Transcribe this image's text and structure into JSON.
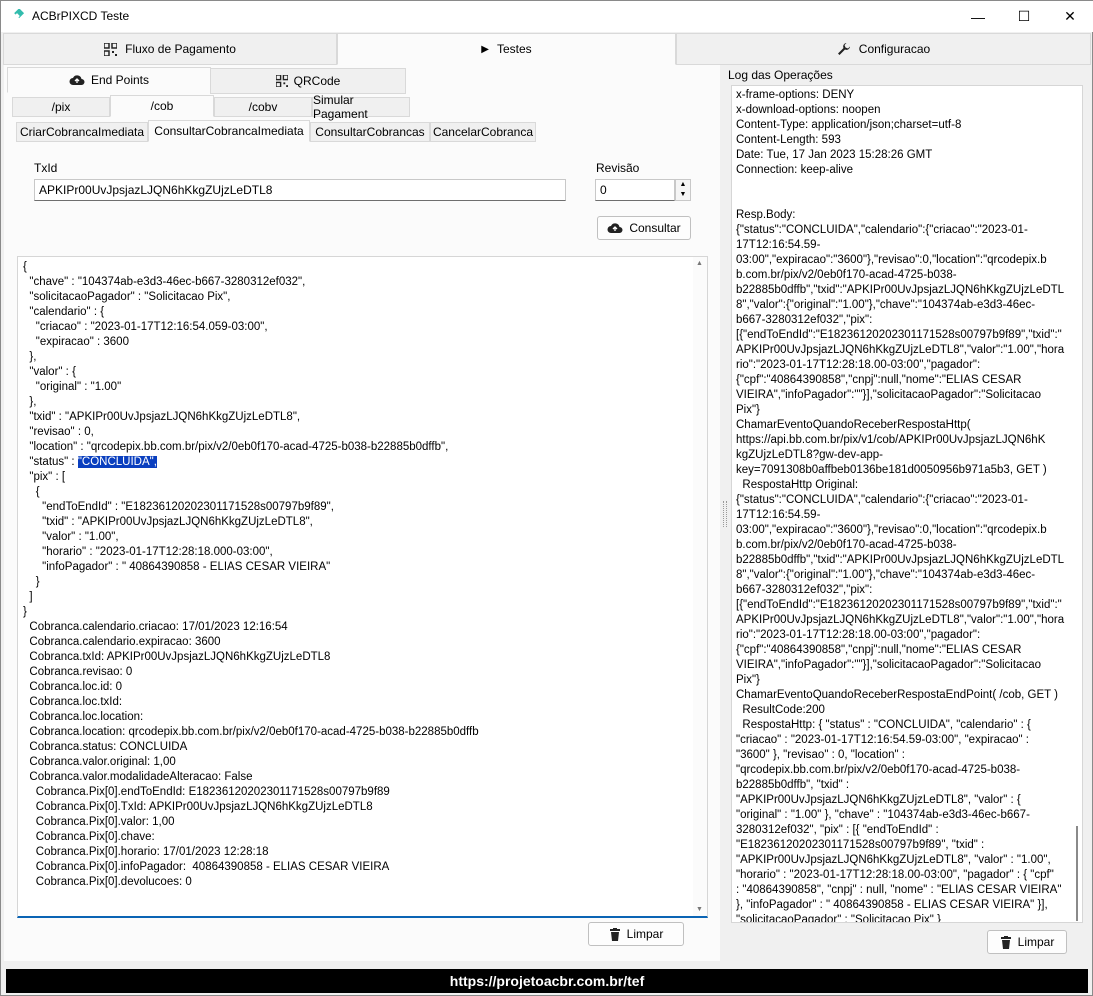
{
  "window": {
    "title": "ACBrPIXCD Teste",
    "controls": {
      "minimize": "—",
      "maximize": "☐",
      "close": "✕"
    }
  },
  "main_tabs": [
    {
      "label": "Fluxo de Pagamento",
      "icon": "qrcode-icon"
    },
    {
      "label": "Testes",
      "icon": "play-icon",
      "active": true
    },
    {
      "label": "Configuracao",
      "icon": "wrench-icon"
    }
  ],
  "sub_tabs": [
    {
      "label": "End Points",
      "icon": "cloud-upload-icon",
      "active": true
    },
    {
      "label": "QRCode",
      "icon": "qrcode-icon"
    }
  ],
  "endpoint_tabs": [
    {
      "label": "/pix"
    },
    {
      "label": "/cob",
      "active": true
    },
    {
      "label": "/cobv"
    },
    {
      "label": "Simular Pagament"
    }
  ],
  "cob_tabs": [
    {
      "label": "CriarCobrancaImediata"
    },
    {
      "label": "ConsultarCobrancaImediata",
      "active": true
    },
    {
      "label": "ConsultarCobrancas"
    },
    {
      "label": "CancelarCobranca"
    }
  ],
  "form": {
    "txid_label": "TxId",
    "txid_value": "APKIPr00UvJpsjazLJQN6hKkgZUjzLeDTL8",
    "revisao_label": "Revisão",
    "revisao_value": "0",
    "consultar_label": "Consultar"
  },
  "result": {
    "before_highlight": "{\n  \"chave\" : \"104374ab-e3d3-46ec-b667-3280312ef032\",\n  \"solicitacaoPagador\" : \"Solicitacao Pix\",\n  \"calendario\" : {\n    \"criacao\" : \"2023-01-17T12:16:54.059-03:00\",\n    \"expiracao\" : 3600\n  },\n  \"valor\" : {\n    \"original\" : \"1.00\"\n  },\n  \"txid\" : \"APKIPr00UvJpsjazLJQN6hKkgZUjzLeDTL8\",\n  \"revisao\" : 0,\n  \"location\" : \"qrcodepix.bb.com.br/pix/v2/0eb0f170-acad-4725-b038-b22885b0dffb\",\n  \"status\" : ",
    "highlight": "\"CONCLUIDA\",",
    "after_highlight": "\n  \"pix\" : [\n    {\n      \"endToEndId\" : \"E18236120202301171528s00797b9f89\",\n      \"txid\" : \"APKIPr00UvJpsjazLJQN6hKkgZUjzLeDTL8\",\n      \"valor\" : \"1.00\",\n      \"horario\" : \"2023-01-17T12:28:18.000-03:00\",\n      \"infoPagador\" : \" 40864390858 - ELIAS CESAR VIEIRA\"\n    }\n  ]\n}\n  Cobranca.calendario.criacao: 17/01/2023 12:16:54\n  Cobranca.calendario.expiracao: 3600\n  Cobranca.txId: APKIPr00UvJpsjazLJQN6hKkgZUjzLeDTL8\n  Cobranca.revisao: 0\n  Cobranca.loc.id: 0\n  Cobranca.loc.txId:\n  Cobranca.loc.location:\n  Cobranca.location: qrcodepix.bb.com.br/pix/v2/0eb0f170-acad-4725-b038-b22885b0dffb\n  Cobranca.status: CONCLUIDA\n  Cobranca.valor.original: 1,00\n  Cobranca.valor.modalidadeAlteracao: False\n    Cobranca.Pix[0].endToEndId: E18236120202301171528s00797b9f89\n    Cobranca.Pix[0].TxId: APKIPr00UvJpsjazLJQN6hKkgZUjzLeDTL8\n    Cobranca.Pix[0].valor: 1,00\n    Cobranca.Pix[0].chave:\n    Cobranca.Pix[0].horario: 17/01/2023 12:28:18\n    Cobranca.Pix[0].infoPagador:  40864390858 - ELIAS CESAR VIEIRA\n    Cobranca.Pix[0].devolucoes: 0",
    "limpar_label": "Limpar"
  },
  "log": {
    "title": "Log das Operações",
    "text": "x-frame-options: DENY\nx-download-options: noopen\nContent-Type: application/json;charset=utf-8\nContent-Length: 593\nDate: Tue, 17 Jan 2023 15:28:26 GMT\nConnection: keep-alive\n\n\nResp.Body:\n{\"status\":\"CONCLUIDA\",\"calendario\":{\"criacao\":\"2023-01-\n17T12:16:54.59-\n03:00\",\"expiracao\":\"3600\"},\"revisao\":0,\"location\":\"qrcodepix.b\nb.com.br/pix/v2/0eb0f170-acad-4725-b038-\nb22885b0dffb\",\"txid\":\"APKIPr00UvJpsjazLJQN6hKkgZUjzLeDTL\n8\",\"valor\":{\"original\":\"1.00\"},\"chave\":\"104374ab-e3d3-46ec-\nb667-3280312ef032\",\"pix\":\n[{\"endToEndId\":\"E18236120202301171528s00797b9f89\",\"txid\":\"\nAPKIPr00UvJpsjazLJQN6hKkgZUjzLeDTL8\",\"valor\":\"1.00\",\"hora\nrio\":\"2023-01-17T12:28:18.00-03:00\",\"pagador\":\n{\"cpf\":\"40864390858\",\"cnpj\":null,\"nome\":\"ELIAS CESAR\nVIEIRA\",\"infoPagador\":\"\"}],\"solicitacaoPagador\":\"Solicitacao\nPix\"}\nChamarEventoQuandoReceberRespostaHttp(\nhttps://api.bb.com.br/pix/v1/cob/APKIPr00UvJpsjazLJQN6hK\nkgZUjzLeDTL8?gw-dev-app-\nkey=7091308b0affbeb0136be181d0050956b971a5b3, GET )\n  RespostaHttp Original:\n{\"status\":\"CONCLUIDA\",\"calendario\":{\"criacao\":\"2023-01-\n17T12:16:54.59-\n03:00\",\"expiracao\":\"3600\"},\"revisao\":0,\"location\":\"qrcodepix.b\nb.com.br/pix/v2/0eb0f170-acad-4725-b038-\nb22885b0dffb\",\"txid\":\"APKIPr00UvJpsjazLJQN6hKkgZUjzLeDTL\n8\",\"valor\":{\"original\":\"1.00\"},\"chave\":\"104374ab-e3d3-46ec-\nb667-3280312ef032\",\"pix\":\n[{\"endToEndId\":\"E18236120202301171528s00797b9f89\",\"txid\":\"\nAPKIPr00UvJpsjazLJQN6hKkgZUjzLeDTL8\",\"valor\":\"1.00\",\"hora\nrio\":\"2023-01-17T12:28:18.00-03:00\",\"pagador\":\n{\"cpf\":\"40864390858\",\"cnpj\":null,\"nome\":\"ELIAS CESAR\nVIEIRA\",\"infoPagador\":\"\"}],\"solicitacaoPagador\":\"Solicitacao\nPix\"}\nChamarEventoQuandoReceberRespostaEndPoint( /cob, GET )\n  ResultCode:200\n  RespostaHttp: { \"status\" : \"CONCLUIDA\", \"calendario\" : {\n\"criacao\" : \"2023-01-17T12:16:54.59-03:00\", \"expiracao\" :\n\"3600\" }, \"revisao\" : 0, \"location\" :\n\"qrcodepix.bb.com.br/pix/v2/0eb0f170-acad-4725-b038-\nb22885b0dffb\", \"txid\" :\n\"APKIPr00UvJpsjazLJQN6hKkgZUjzLeDTL8\", \"valor\" : {\n\"original\" : \"1.00\" }, \"chave\" : \"104374ab-e3d3-46ec-b667-\n3280312ef032\", \"pix\" : [{ \"endToEndId\" :\n\"E18236120202301171528s00797b9f89\", \"txid\" :\n\"APKIPr00UvJpsjazLJQN6hKkgZUjzLeDTL8\", \"valor\" : \"1.00\",\n\"horario\" : \"2023-01-17T12:28:18.00-03:00\", \"pagador\" : { \"cpf\"\n: \"40864390858\", \"cnpj\" : null, \"nome\" : \"ELIAS CESAR VIEIRA\"\n}, \"infoPagador\" : \" 40864390858 - ELIAS CESAR VIEIRA\" }],\n\"solicitacaoPagador\" : \"Solicitacao Pix\" }",
    "limpar_label": "Limpar"
  },
  "footer": {
    "text": "https://projetoacbr.com.br/tef"
  }
}
